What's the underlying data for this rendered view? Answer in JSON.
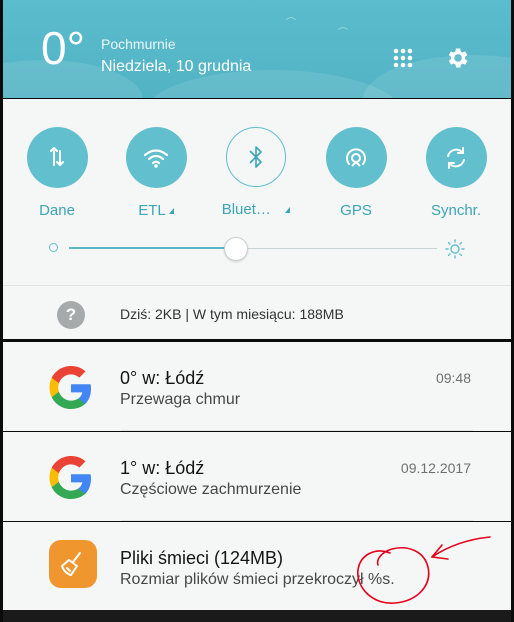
{
  "header": {
    "temperature": "0°",
    "condition": "Pochmurnie",
    "date": "Niedziela, 10 grudnia",
    "icons": [
      "apps-grid-icon",
      "gear-icon"
    ]
  },
  "quick_settings": {
    "tiles": [
      {
        "label": "Dane",
        "icon": "mobile-data-icon",
        "active": true
      },
      {
        "label": "ETL",
        "icon": "wifi-icon",
        "active": true,
        "has_dropdown": true
      },
      {
        "label": "Bluet…",
        "icon": "bluetooth-icon",
        "active": false,
        "has_dropdown": true
      },
      {
        "label": "GPS",
        "icon": "location-icon",
        "active": true
      },
      {
        "label": "Synchr.",
        "icon": "sync-icon",
        "active": true
      }
    ],
    "brightness_level": 0.45,
    "data_usage": "Dziś: 2KB | W tym miesiącu: 188MB",
    "help_symbol": "?"
  },
  "notifications": [
    {
      "icon": "google-icon",
      "title": "0° w: Łódź",
      "subtitle": "Przewaga chmur",
      "time": "09:48"
    },
    {
      "icon": "google-icon",
      "title": "1° w: Łódź",
      "subtitle": "Częściowe zachmurzenie",
      "time": "09.12.2017"
    },
    {
      "icon": "broom-icon",
      "title": "Pliki śmieci (124MB)",
      "subtitle": "Rozmiar plików śmieci przekroczył %s.",
      "time": ""
    }
  ],
  "colors": {
    "header_bg": "#5bbccd",
    "accent": "#62bfcd",
    "panel_bg": "#f5f6f6",
    "cleaner_icon": "#f0962e",
    "annotation": "#e3001b"
  }
}
